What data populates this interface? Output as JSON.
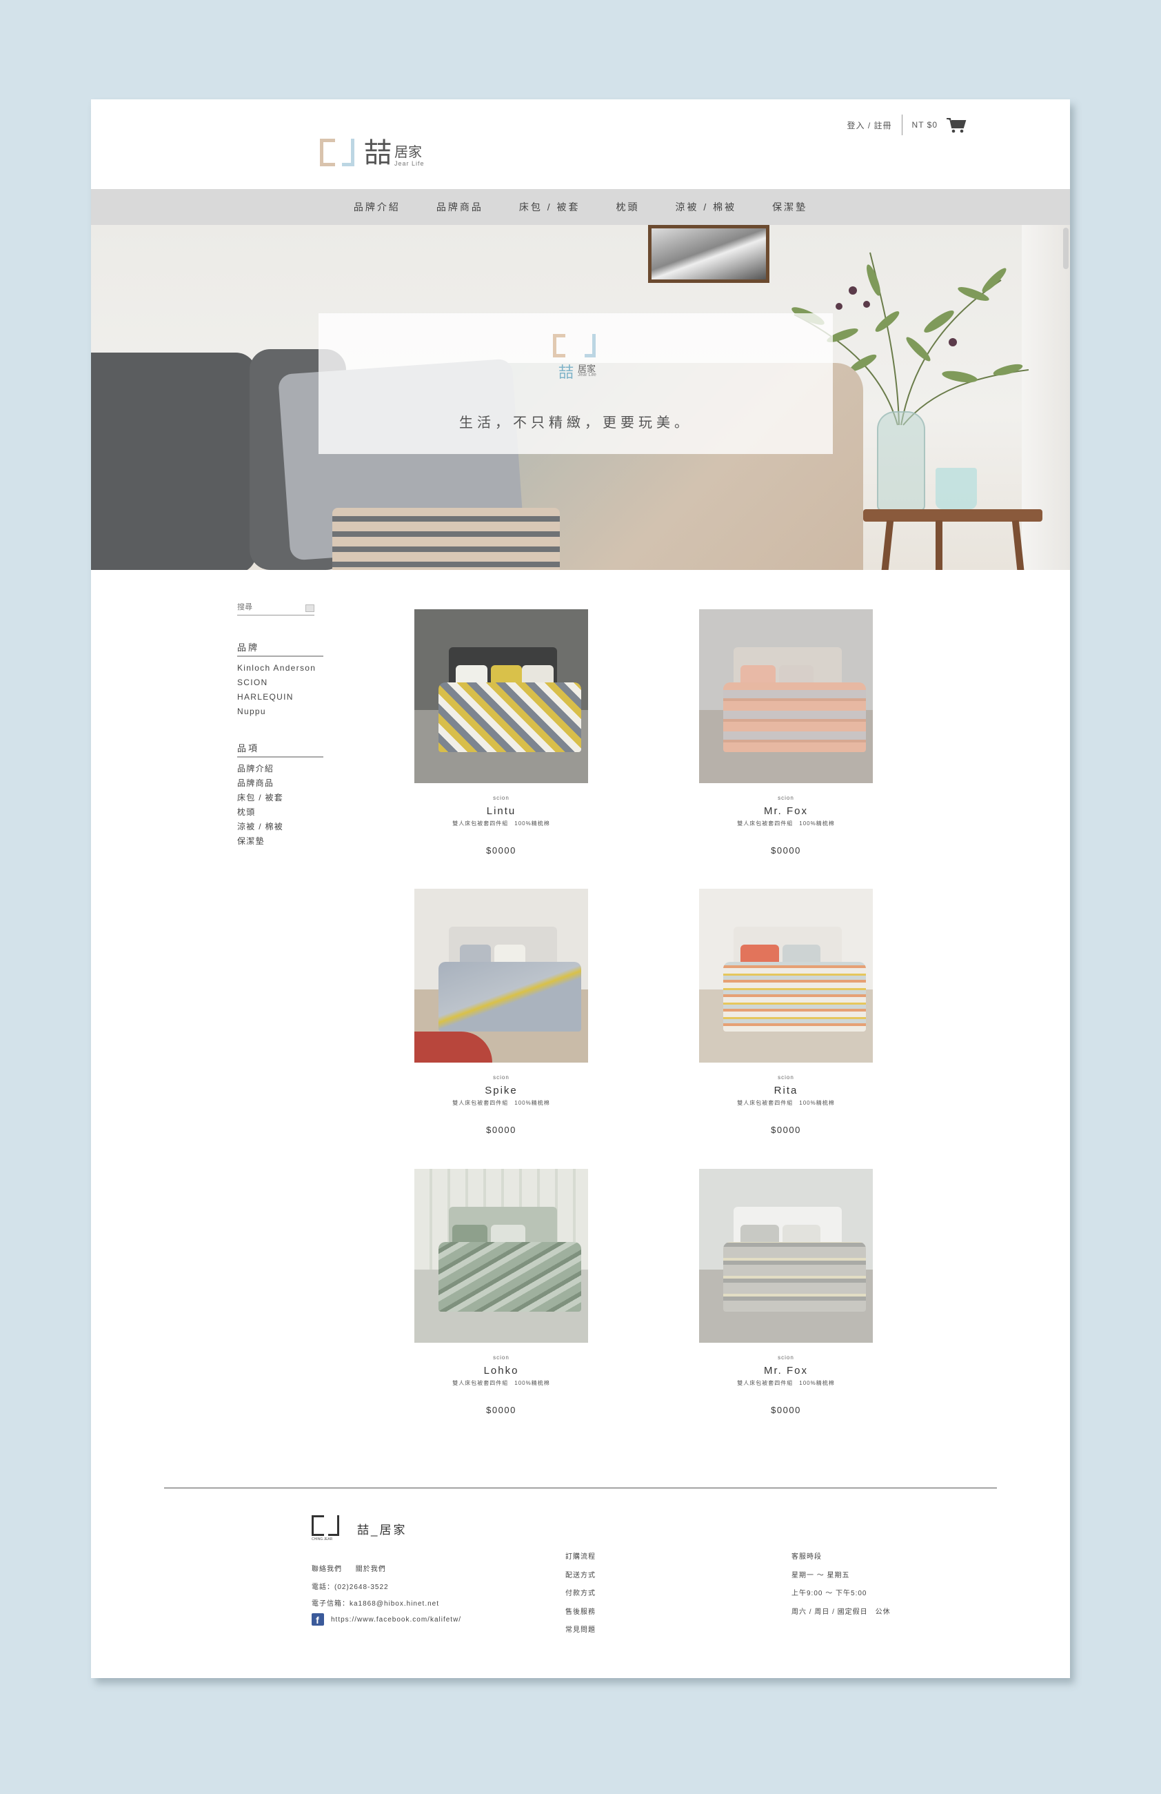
{
  "header": {
    "logo_main": "喆",
    "logo_sub": "居家",
    "logo_en": "Jear Life",
    "login": "登入 / 註冊",
    "cart_total": "NT $0"
  },
  "nav": [
    "品牌介紹",
    "品牌商品",
    "床包 / 被套",
    "枕頭",
    "涼被 / 棉被",
    "保潔墊"
  ],
  "hero": {
    "logo_main": "喆",
    "logo_sub": "居家",
    "logo_en": "Jear Life",
    "slogan": "生活，不只精緻，更要玩美。"
  },
  "sidebar": {
    "search_placeholder": "搜尋",
    "brand_heading": "品牌",
    "brands": [
      "Kinloch Anderson",
      "SCION",
      "HARLEQUIN",
      "Nuppu"
    ],
    "category_heading": "品項",
    "categories": [
      "品牌介紹",
      "品牌商品",
      "床包 / 被套",
      "枕頭",
      "涼被 / 棉被",
      "保潔墊"
    ]
  },
  "products": [
    {
      "brand": "scion",
      "name": "Lintu",
      "desc": "雙人床包被套四件組　100%精梳棉",
      "price": "$0000"
    },
    {
      "brand": "scion",
      "name": "Mr. Fox",
      "desc": "雙人床包被套四件組　100%精梳棉",
      "price": "$0000"
    },
    {
      "brand": "scion",
      "name": "Spike",
      "desc": "雙人床包被套四件組　100%精梳棉",
      "price": "$0000"
    },
    {
      "brand": "scion",
      "name": "Rita",
      "desc": "雙人床包被套四件組　100%精梳棉",
      "price": "$0000"
    },
    {
      "brand": "scion",
      "name": "Lohko",
      "desc": "雙人床包被套四件組　100%精梳棉",
      "price": "$0000"
    },
    {
      "brand": "scion",
      "name": "Mr. Fox",
      "desc": "雙人床包被套四件組　100%精梳棉",
      "price": "$0000"
    }
  ],
  "footer": {
    "logo_caption": "CHING JEAR",
    "brand": "喆_居家",
    "links": [
      "聯絡我們",
      "關於我們"
    ],
    "phone": "電話：(02)2648-3522",
    "email": "電子信箱：ka1868@hibox.hinet.net",
    "facebook": "https://www.facebook.com/kalifetw/",
    "services": [
      "訂購流程",
      "配送方式",
      "付款方式",
      "售後服務",
      "常見問題"
    ],
    "hours_title": "客服時段",
    "hours": [
      "星期一 ～ 星期五",
      "上午9:00 ～ 下午5:00",
      "周六 / 周日 / 國定假日　公休"
    ]
  }
}
